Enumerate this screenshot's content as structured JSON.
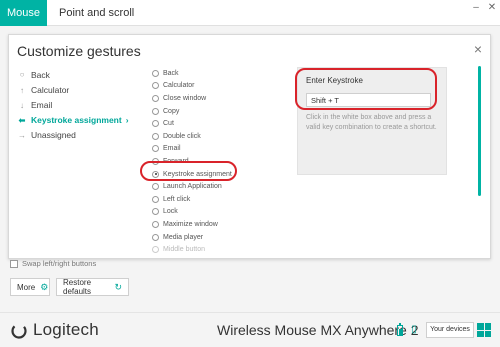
{
  "tabs": [
    {
      "label": "Mouse",
      "active": true
    },
    {
      "label": "Point and scroll",
      "active": false
    }
  ],
  "window": {
    "minimize": "–",
    "close": "✕"
  },
  "dialog": {
    "title": "Customize gestures",
    "close_icon": "×",
    "gestures": [
      {
        "icon": "circle-outline-icon",
        "glyph": "○",
        "label": "Back",
        "selected": false
      },
      {
        "icon": "arrow-up-icon",
        "glyph": "↑",
        "label": "Calculator",
        "selected": false
      },
      {
        "icon": "arrow-down-icon",
        "glyph": "↓",
        "label": "Email",
        "selected": false
      },
      {
        "icon": "arrow-left-icon",
        "glyph": "◆",
        "label": "Keystroke assignment",
        "selected": true,
        "suffix": "›"
      },
      {
        "icon": "arrow-right-icon",
        "glyph": "→",
        "label": "Unassigned",
        "selected": false
      }
    ],
    "actions": [
      {
        "label": "Back",
        "checked": false
      },
      {
        "label": "Calculator",
        "checked": false
      },
      {
        "label": "Close window",
        "checked": false
      },
      {
        "label": "Copy",
        "checked": false
      },
      {
        "label": "Cut",
        "checked": false
      },
      {
        "label": "Double click",
        "checked": false
      },
      {
        "label": "Email",
        "checked": false
      },
      {
        "label": "Forward",
        "checked": false
      },
      {
        "label": "Keystroke assignment",
        "checked": true
      },
      {
        "label": "Launch Application",
        "checked": false
      },
      {
        "label": "Left click",
        "checked": false
      },
      {
        "label": "Lock",
        "checked": false
      },
      {
        "label": "Maximize window",
        "checked": false
      },
      {
        "label": "Media player",
        "checked": false
      },
      {
        "label": "Middle button",
        "checked": false,
        "faded": true
      }
    ],
    "keystroke": {
      "title": "Enter Keystroke",
      "value": "Shift + T",
      "help": "Click in the white box above and press a valid key combination to create a shortcut."
    },
    "accent": "#00b3a4",
    "highlight": "#d9232a"
  },
  "swap_label": "Swap left/right buttons",
  "buttons": {
    "more": "More",
    "restore": "Restore defaults"
  },
  "footer": {
    "brand": "Logitech",
    "device": "Wireless Mouse MX Anywhere 2",
    "your_devices": "Your devices"
  }
}
